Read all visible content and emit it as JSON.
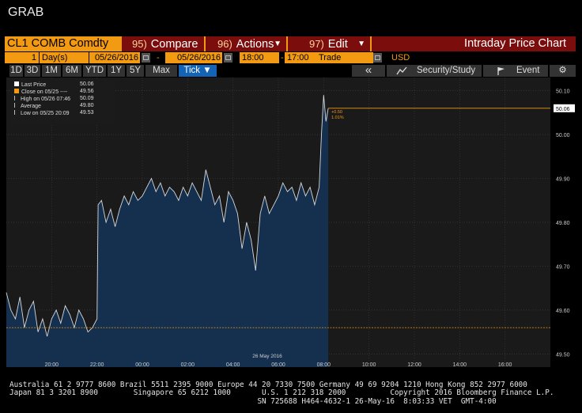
{
  "window": {
    "title": "GRAB"
  },
  "menu": {
    "ticker": "CL1 COMB Comdty",
    "compare": {
      "num": "95)",
      "label": "Compare"
    },
    "actions": {
      "num": "96)",
      "label": "Actions"
    },
    "edit": {
      "num": "97)",
      "label": "Edit"
    },
    "screen_title": "Intraday Price Chart"
  },
  "params": {
    "period_count": "1",
    "period_unit": "Day(s)",
    "start_date": "05/26/2016",
    "end_date": "05/26/2016",
    "start_time": "18:00",
    "end_time": "17:00",
    "field": "Trade",
    "currency": "USD",
    "dash": "-"
  },
  "toolbar": {
    "ranges": [
      "1D",
      "3D",
      "1M",
      "6M",
      "YTD",
      "1Y",
      "5Y",
      "Max"
    ],
    "tick": "Tick ▼",
    "collapse": "«",
    "security_study": "Security/Study",
    "event": "Event"
  },
  "legend": {
    "rows": [
      {
        "label": "Last Price",
        "value": "50.06",
        "color": "#ffffff"
      },
      {
        "label": "Close on 05/25 ----",
        "value": "49.56",
        "color": "#f29a12"
      },
      {
        "label": "High on 05/26 07:46",
        "value": "50.09",
        "color": "#bbbbbb"
      },
      {
        "label": "Average",
        "value": "49.80",
        "color": "#bbbbbb"
      },
      {
        "label": "Low on 05/25 20:09",
        "value": "49.53",
        "color": "#bbbbbb"
      }
    ]
  },
  "chart_data": {
    "type": "area",
    "title": "",
    "ylim": [
      49.47,
      50.13
    ],
    "y_ticks": [
      "50.10",
      "50.00",
      "49.90",
      "49.80",
      "49.70",
      "49.60",
      "49.50"
    ],
    "y_tick_values": [
      50.1,
      50.0,
      49.9,
      49.8,
      49.7,
      49.6,
      49.5
    ],
    "x_ticks": [
      "20:00",
      "22:00",
      "00:00",
      "02:00",
      "04:00",
      "06:00",
      "08:00",
      "10:00",
      "12:00",
      "14:00",
      "16:00"
    ],
    "x_tick_hours": [
      20,
      22,
      24,
      26,
      28,
      30,
      32,
      34,
      36,
      38,
      40
    ],
    "xlim_hours": [
      18,
      42
    ],
    "date_label": "26 May 2016",
    "date_label_hour": 24,
    "last_price_label": "50.06",
    "last_price": 50.06,
    "prev_close": 49.56,
    "change": "+0.50",
    "change_pct": "1.01%",
    "grid": true,
    "series": [
      {
        "x": [
          18.0,
          18.2,
          18.4,
          18.6,
          18.8,
          19.0,
          19.2,
          19.4,
          19.6,
          19.8,
          20.0,
          20.2,
          20.4,
          20.6,
          20.8,
          21.0,
          21.2,
          21.4,
          21.6,
          21.8,
          22.0,
          22.05,
          22.2,
          22.4,
          22.6,
          22.8,
          23.0,
          23.2,
          23.4,
          23.6,
          23.8,
          24.0,
          24.2,
          24.4,
          24.6,
          24.8,
          25.0,
          25.2,
          25.4,
          25.6,
          25.8,
          26.0,
          26.2,
          26.4,
          26.6,
          26.8,
          27.0,
          27.2,
          27.4,
          27.6,
          27.8,
          28.0,
          28.2,
          28.4,
          28.6,
          28.8,
          29.0,
          29.2,
          29.4,
          29.6,
          29.8,
          30.0,
          30.2,
          30.4,
          30.6,
          30.8,
          31.0,
          31.2,
          31.4,
          31.6,
          31.8,
          31.9,
          32.0,
          32.1,
          32.2
        ],
        "y": [
          49.64,
          49.6,
          49.58,
          49.63,
          49.56,
          49.6,
          49.62,
          49.55,
          49.58,
          49.54,
          49.58,
          49.6,
          49.57,
          49.61,
          49.59,
          49.56,
          49.6,
          49.58,
          49.55,
          49.56,
          49.58,
          49.84,
          49.85,
          49.8,
          49.83,
          49.79,
          49.83,
          49.86,
          49.84,
          49.87,
          49.85,
          49.86,
          49.88,
          49.9,
          49.87,
          49.89,
          49.86,
          49.88,
          49.87,
          49.85,
          49.88,
          49.86,
          49.89,
          49.87,
          49.85,
          49.92,
          49.88,
          49.84,
          49.86,
          49.8,
          49.87,
          49.85,
          49.82,
          49.74,
          49.8,
          49.76,
          49.69,
          49.82,
          49.86,
          49.82,
          49.84,
          49.86,
          49.89,
          49.87,
          49.88,
          49.85,
          49.89,
          49.86,
          49.88,
          49.84,
          49.88,
          50.0,
          50.09,
          50.03,
          50.06
        ]
      }
    ]
  },
  "footer": {
    "line1": "Australia 61 2 9777 8600 Brazil 5511 2395 9000 Europe 44 20 7330 7500 Germany 49 69 9204 1210 Hong Kong 852 2977 6000",
    "line2": "Japan 81 3 3201 8900        Singapore 65 6212 1000       U.S. 1 212 318 2000          Copyright 2016 Bloomberg Finance L.P.",
    "line3": "                                                        SN 725688 H464-4632-1 26-May-16  8:03:33 VET  GMT-4:00"
  }
}
